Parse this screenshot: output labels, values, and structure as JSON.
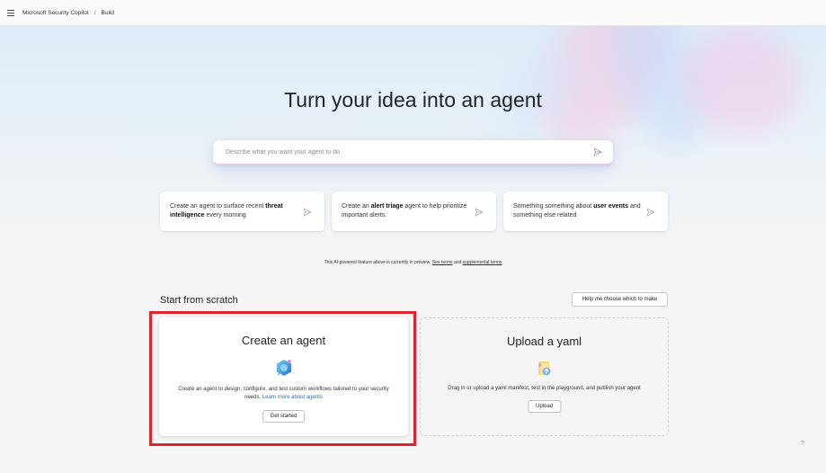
{
  "topbar": {
    "menu_icon": "hamburger-icon",
    "breadcrumb": [
      "Microsoft Security Copilot",
      "Build"
    ],
    "separator": "/"
  },
  "hero": {
    "title": "Turn your idea into an agent",
    "prompt_placeholder": "Describe what you want your agent to do",
    "send_icon": "send-icon"
  },
  "suggestions": [
    {
      "pre": "Create an agent to surface recent ",
      "bold": "threat intelligence",
      "post": " every morning"
    },
    {
      "pre": "Create an ",
      "bold": "alert triage",
      "post": " agent to help prioritize important alerts."
    },
    {
      "pre": "Something something about ",
      "bold": "user events",
      "post": " and something else related"
    }
  ],
  "disclaimer": {
    "text": "This AI-powered feature above is currently in preview.",
    "link1": "See terms",
    "and": "and",
    "link2": "supplemental terms"
  },
  "scratch": {
    "title": "Start from scratch",
    "help_button": "Help me choose which to make"
  },
  "cards": {
    "create": {
      "title": "Create an agent",
      "description": "Create an agent to design, configure, and test custom workflows tailored to your security needs.",
      "link": "Learn more about agents",
      "button": "Get started"
    },
    "upload": {
      "title": "Upload a yaml",
      "description": "Drag in or upload a yaml manifest, test in the playground, and publish your agent",
      "button": "Upload"
    }
  },
  "help_glyph": "?",
  "colors": {
    "highlight": "#d9262f",
    "link": "#2a6fb0"
  }
}
